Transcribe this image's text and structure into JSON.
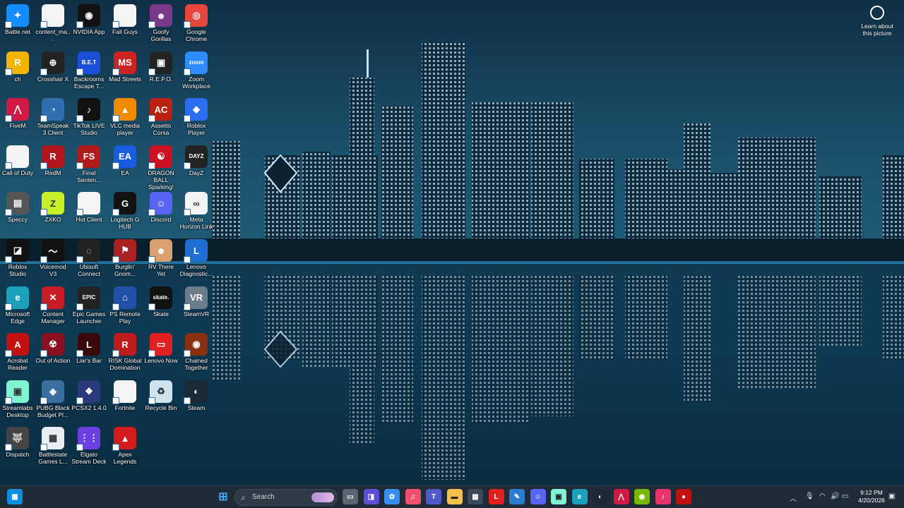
{
  "learn": {
    "label_line1": "Learn about",
    "label_line2": "this picture"
  },
  "icons": [
    {
      "label": "Battle.net",
      "color": "#148eff",
      "glyph": "✦"
    },
    {
      "label": "content_ma...",
      "color": "#f4f4f4",
      "glyph": ""
    },
    {
      "label": "NVIDIA App",
      "color": "#111",
      "glyph": "◉"
    },
    {
      "label": "Fall Guys",
      "color": "#f4f4f4",
      "glyph": ""
    },
    {
      "label": "Goofy Gorillas",
      "color": "#7a3a8a",
      "glyph": "☻"
    },
    {
      "label": "Google Chrome",
      "color": "#e8453c",
      "glyph": "◎"
    },
    {
      "label": "ch",
      "color": "#f5b400",
      "glyph": "R"
    },
    {
      "label": "Crosshair X",
      "color": "#222",
      "glyph": "⊕"
    },
    {
      "label": "Backrooms Escape T...",
      "color": "#1a4fd8",
      "glyph": "B.E.T"
    },
    {
      "label": "Mad Streets",
      "color": "#c22",
      "glyph": "MS"
    },
    {
      "label": "R.E.P.O.",
      "color": "#222",
      "glyph": "▣"
    },
    {
      "label": "Zoom Workplace",
      "color": "#2d8cff",
      "glyph": "zoom"
    },
    {
      "label": "FiveM",
      "color": "#d01a45",
      "glyph": "⋀"
    },
    {
      "label": "TeamSpeak 3 Client",
      "color": "#2f6fb0",
      "glyph": "◔"
    },
    {
      "label": "TikTok LIVE Studio",
      "color": "#111",
      "glyph": "♪"
    },
    {
      "label": "VLC media player",
      "color": "#f08a00",
      "glyph": "▲"
    },
    {
      "label": "Assetto Corsa",
      "color": "#b21",
      "glyph": "AC"
    },
    {
      "label": "Roblox Player",
      "color": "#2b6ef0",
      "glyph": "◆"
    },
    {
      "label": "Call of Duty",
      "color": "#f4f4f4",
      "glyph": ""
    },
    {
      "label": "RedM",
      "color": "#b4141b",
      "glyph": "R"
    },
    {
      "label": "Final Senten...",
      "color": "#b01a1a",
      "glyph": "FS"
    },
    {
      "label": "EA",
      "color": "#1a5ce0",
      "glyph": "EA"
    },
    {
      "label": "DRAGON BALL Sparking! ZERO",
      "color": "#c12",
      "glyph": "☯"
    },
    {
      "label": "DayZ",
      "color": "#222",
      "glyph": "DAYZ"
    },
    {
      "label": "Speccy",
      "color": "#555",
      "glyph": "▤"
    },
    {
      "label": "ZXKO",
      "color": "#c8f02a",
      "glyph": "Z"
    },
    {
      "label": "Hot Client",
      "color": "#f4f4f4",
      "glyph": ""
    },
    {
      "label": "Logitech G HUB",
      "color": "#111",
      "glyph": "G"
    },
    {
      "label": "Discord",
      "color": "#5865f2",
      "glyph": "☺"
    },
    {
      "label": "Meta Horizon Link",
      "color": "#f4f4f4",
      "glyph": "∞"
    },
    {
      "label": "Roblox Studio",
      "color": "#111",
      "glyph": "◪"
    },
    {
      "label": "Voicemod V3",
      "color": "#111",
      "glyph": "〜"
    },
    {
      "label": "Ubisoft Connect",
      "color": "#222",
      "glyph": "◌"
    },
    {
      "label": "Burglin' Gnom...",
      "color": "#a22",
      "glyph": "⚑"
    },
    {
      "label": "RV There Yet",
      "color": "#d9a070",
      "glyph": "☻"
    },
    {
      "label": "Lenovo Diagnostic...",
      "color": "#1f6ed4",
      "glyph": "L"
    },
    {
      "label": "Microsoft Edge",
      "color": "#1aa0b8",
      "glyph": "e"
    },
    {
      "label": "Content Manager",
      "color": "#c81d25",
      "glyph": "✕"
    },
    {
      "label": "Epic Games Launcher",
      "color": "#222",
      "glyph": "EPIC"
    },
    {
      "label": "PS Remote Play",
      "color": "#2050a8",
      "glyph": "⌂"
    },
    {
      "label": "Skate",
      "color": "#111",
      "glyph": "skate."
    },
    {
      "label": "SteamVR",
      "color": "#6d7c8a",
      "glyph": "VR"
    },
    {
      "label": "Acrobat Reader",
      "color": "#c21010",
      "glyph": "A"
    },
    {
      "label": "Out of Action",
      "color": "#8a1020",
      "glyph": "☢"
    },
    {
      "label": "Liar's Bar",
      "color": "#3a0a0a",
      "glyph": "L"
    },
    {
      "label": "RISK Global Domination",
      "color": "#c01a1a",
      "glyph": "R"
    },
    {
      "label": "Lenovo Now",
      "color": "#e02020",
      "glyph": "▭"
    },
    {
      "label": "Chained Together",
      "color": "#8a3010",
      "glyph": "◉"
    },
    {
      "label": "Streamlabs Desktop",
      "color": "#80f5d2",
      "glyph": "▣"
    },
    {
      "label": "PUBG Black Budget Pl...",
      "color": "#3a6fa0",
      "glyph": "◈"
    },
    {
      "label": "PCSX2 1.4.0",
      "color": "#2a3a7a",
      "glyph": "❖"
    },
    {
      "label": "Fortnite",
      "color": "#f4f4f4",
      "glyph": ""
    },
    {
      "label": "Recycle Bin",
      "color": "#cfe2f0",
      "glyph": "♻"
    },
    {
      "label": "Steam",
      "color": "#1b2838",
      "glyph": "◐"
    },
    {
      "label": "Dispatch",
      "color": "#444",
      "glyph": "🐺"
    },
    {
      "label": "Battlestate Games L...",
      "color": "#e8eef2",
      "glyph": "▦"
    },
    {
      "label": "Elgato Stream Deck",
      "color": "#6b3fe0",
      "glyph": "⋮⋮"
    },
    {
      "label": "Apex Legends",
      "color": "#d41c1c",
      "glyph": "▲"
    }
  ],
  "taskbar": {
    "search_placeholder": "Search",
    "apps": [
      {
        "name": "task-view",
        "color": "#5a6670",
        "glyph": "▭"
      },
      {
        "name": "zoom",
        "color": "#5b4fd8",
        "glyph": "◨"
      },
      {
        "name": "copilot",
        "color": "#3a8df0",
        "glyph": "✿"
      },
      {
        "name": "itunes",
        "color": "#f0506e",
        "glyph": "♫"
      },
      {
        "name": "teams",
        "color": "#5059c9",
        "glyph": "T"
      },
      {
        "name": "file-explorer",
        "color": "#f2c14e",
        "glyph": "▬"
      },
      {
        "name": "store",
        "color": "#3a4a5a",
        "glyph": "▦"
      },
      {
        "name": "lenovo",
        "color": "#e02020",
        "glyph": "L"
      },
      {
        "name": "notes",
        "color": "#2a7ad0",
        "glyph": "✎"
      },
      {
        "name": "discord",
        "color": "#5865f2",
        "glyph": "☺"
      },
      {
        "name": "streamlabs",
        "color": "#80f5d2",
        "glyph": "▣"
      },
      {
        "name": "edge",
        "color": "#1aa0b8",
        "glyph": "e"
      },
      {
        "name": "steam",
        "color": "#1b2838",
        "glyph": "◐"
      },
      {
        "name": "fivem",
        "color": "#d01a45",
        "glyph": "⋀"
      },
      {
        "name": "nvidia",
        "color": "#76b900",
        "glyph": "◉"
      },
      {
        "name": "tiktok",
        "color": "#e8336b",
        "glyph": "♪"
      },
      {
        "name": "redm",
        "color": "#c01010",
        "glyph": "●"
      }
    ],
    "clock_time": "9:12 PM",
    "clock_date": "4/20/2026"
  }
}
